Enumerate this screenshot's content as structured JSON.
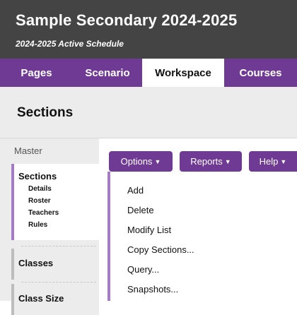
{
  "header": {
    "title": "Sample Secondary 2024-2025",
    "subtitle": "2024-2025 Active Schedule"
  },
  "tabs": [
    {
      "label": "Pages",
      "active": false
    },
    {
      "label": "Scenario",
      "active": false
    },
    {
      "label": "Workspace",
      "active": true
    },
    {
      "label": "Courses",
      "active": false
    }
  ],
  "page": {
    "title": "Sections"
  },
  "sidebar": {
    "master_label": "Master",
    "active_section": {
      "label": "Sections",
      "subitems": [
        "Details",
        "Roster",
        "Teachers",
        "Rules"
      ]
    },
    "items": [
      "Classes",
      "Class Size"
    ]
  },
  "toolbar": {
    "options_label": "Options",
    "reports_label": "Reports",
    "help_label": "Help"
  },
  "menu": {
    "items": [
      "Add",
      "Delete",
      "Modify List",
      "Copy Sections...",
      "Query...",
      "Snapshots..."
    ]
  },
  "colors": {
    "header_bg": "#444444",
    "accent_purple": "#6f3a93",
    "accent_light": "#a67bc5"
  },
  "icons": {
    "dropdown": "caret-down-icon"
  }
}
